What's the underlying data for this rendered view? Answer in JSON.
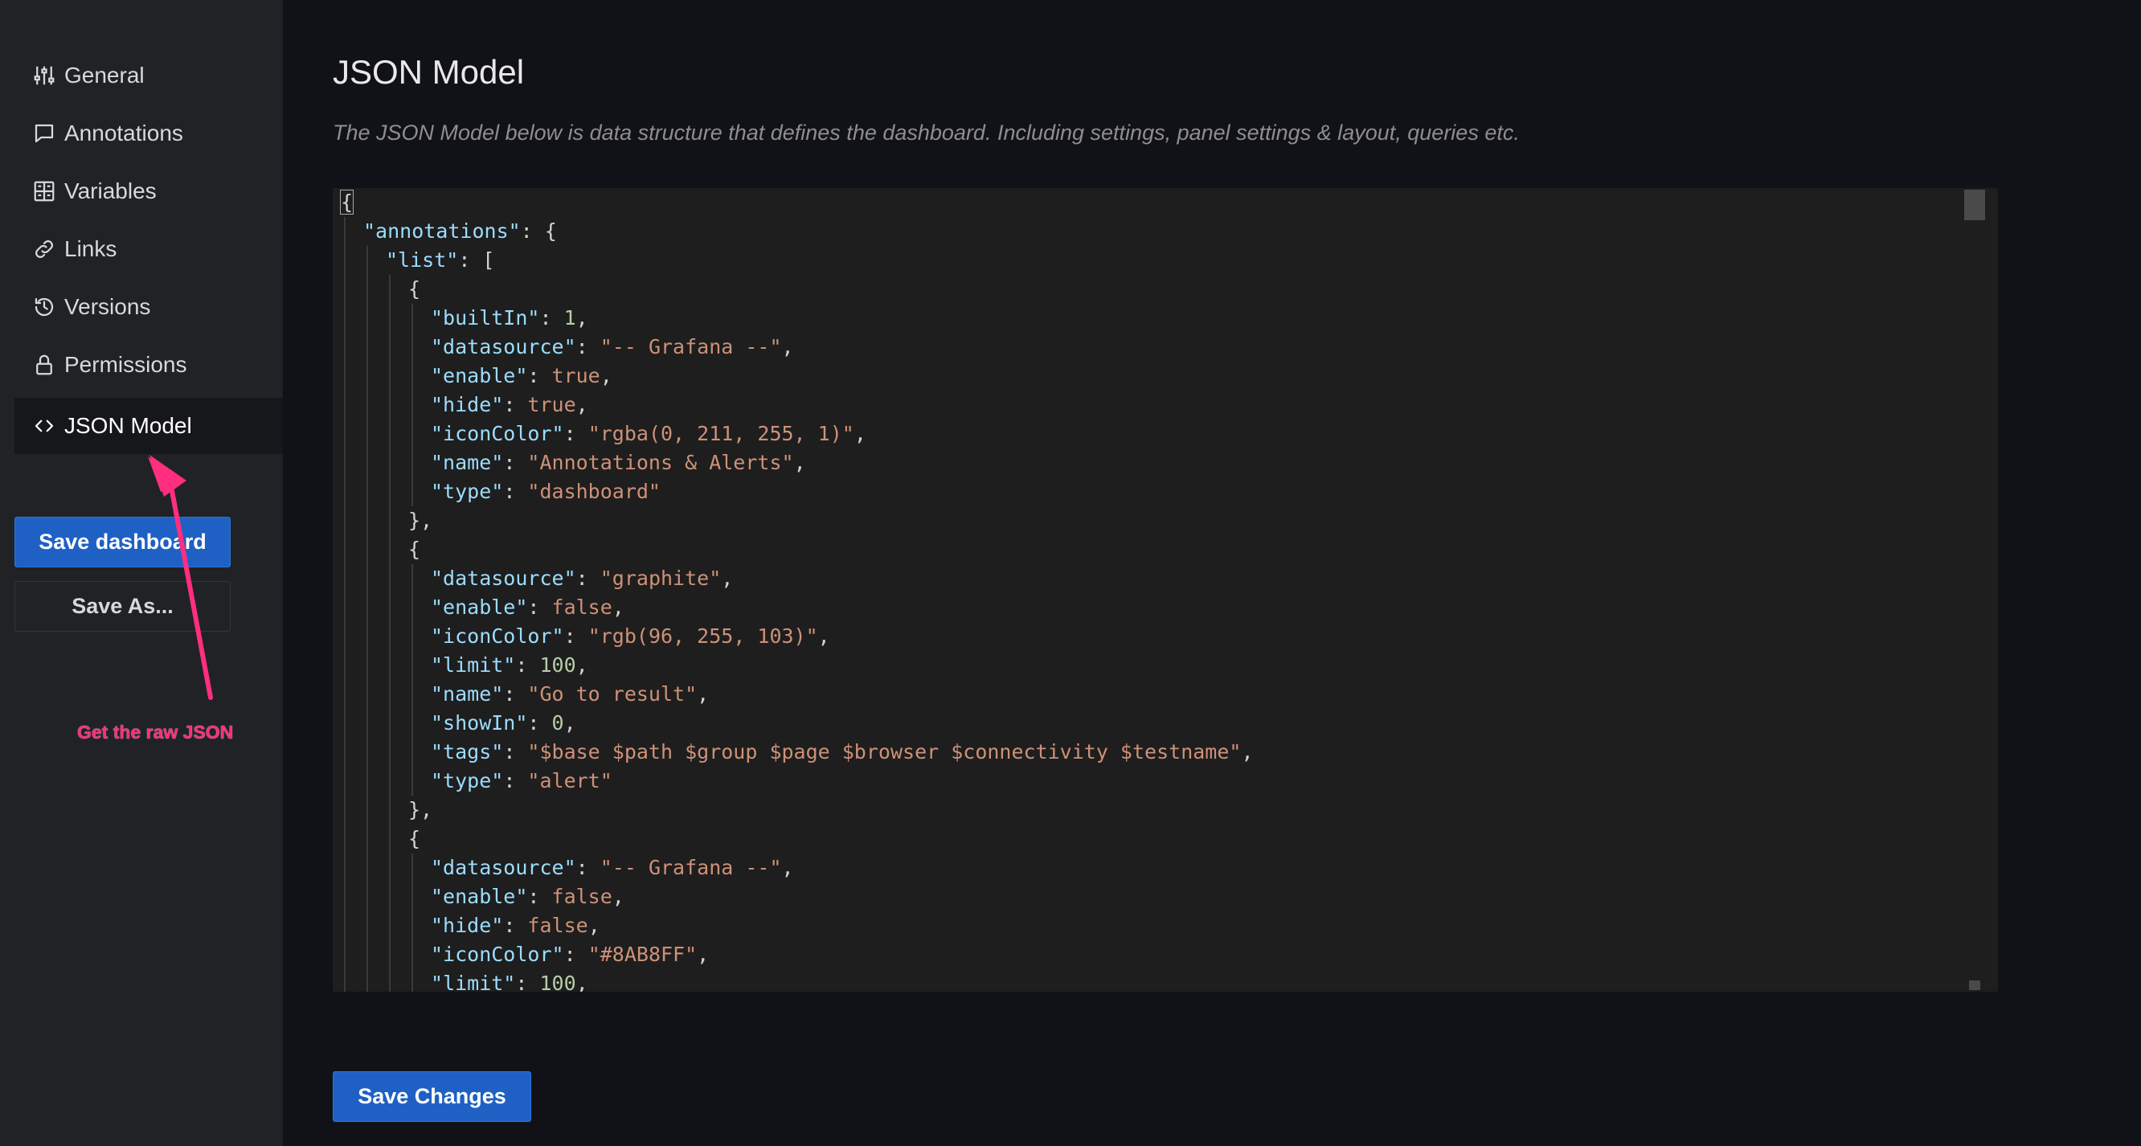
{
  "sidebar": {
    "items": [
      {
        "label": "General",
        "icon": "sliders-icon"
      },
      {
        "label": "Annotations",
        "icon": "comment-icon"
      },
      {
        "label": "Variables",
        "icon": "variables-icon"
      },
      {
        "label": "Links",
        "icon": "link-icon"
      },
      {
        "label": "Versions",
        "icon": "history-icon"
      },
      {
        "label": "Permissions",
        "icon": "lock-icon"
      },
      {
        "label": "JSON Model",
        "icon": "code-brackets-icon"
      }
    ],
    "active_item": "JSON Model",
    "save_dashboard_label": "Save dashboard",
    "save_as_label": "Save As..."
  },
  "main": {
    "title": "JSON Model",
    "description": "The JSON Model below is data structure that defines the dashboard. Including settings, panel settings & layout, queries etc.",
    "save_changes_label": "Save Changes"
  },
  "annotation": {
    "text": "Get the raw JSON"
  },
  "editor": {
    "lines": [
      {
        "indent": 0,
        "tokens": [
          {
            "t": "{",
            "c": "p",
            "cursor": true
          }
        ]
      },
      {
        "indent": 1,
        "tokens": [
          {
            "t": "\"annotations\"",
            "c": "k"
          },
          {
            "t": ": {",
            "c": "p"
          }
        ]
      },
      {
        "indent": 2,
        "tokens": [
          {
            "t": "\"list\"",
            "c": "k"
          },
          {
            "t": ": [",
            "c": "p"
          }
        ]
      },
      {
        "indent": 3,
        "tokens": [
          {
            "t": "{",
            "c": "p"
          }
        ]
      },
      {
        "indent": 4,
        "tokens": [
          {
            "t": "\"builtIn\"",
            "c": "k"
          },
          {
            "t": ": ",
            "c": "p"
          },
          {
            "t": "1",
            "c": "n"
          },
          {
            "t": ",",
            "c": "p"
          }
        ]
      },
      {
        "indent": 4,
        "tokens": [
          {
            "t": "\"datasource\"",
            "c": "k"
          },
          {
            "t": ": ",
            "c": "p"
          },
          {
            "t": "\"-- Grafana --\"",
            "c": "s"
          },
          {
            "t": ",",
            "c": "p"
          }
        ]
      },
      {
        "indent": 4,
        "tokens": [
          {
            "t": "\"enable\"",
            "c": "k"
          },
          {
            "t": ": ",
            "c": "p"
          },
          {
            "t": "true",
            "c": "b"
          },
          {
            "t": ",",
            "c": "p"
          }
        ]
      },
      {
        "indent": 4,
        "tokens": [
          {
            "t": "\"hide\"",
            "c": "k"
          },
          {
            "t": ": ",
            "c": "p"
          },
          {
            "t": "true",
            "c": "b"
          },
          {
            "t": ",",
            "c": "p"
          }
        ]
      },
      {
        "indent": 4,
        "tokens": [
          {
            "t": "\"iconColor\"",
            "c": "k"
          },
          {
            "t": ": ",
            "c": "p"
          },
          {
            "t": "\"rgba(0, 211, 255, 1)\"",
            "c": "s"
          },
          {
            "t": ",",
            "c": "p"
          }
        ]
      },
      {
        "indent": 4,
        "tokens": [
          {
            "t": "\"name\"",
            "c": "k"
          },
          {
            "t": ": ",
            "c": "p"
          },
          {
            "t": "\"Annotations & Alerts\"",
            "c": "s"
          },
          {
            "t": ",",
            "c": "p"
          }
        ]
      },
      {
        "indent": 4,
        "tokens": [
          {
            "t": "\"type\"",
            "c": "k"
          },
          {
            "t": ": ",
            "c": "p"
          },
          {
            "t": "\"dashboard\"",
            "c": "s"
          }
        ]
      },
      {
        "indent": 3,
        "tokens": [
          {
            "t": "},",
            "c": "p"
          }
        ]
      },
      {
        "indent": 3,
        "tokens": [
          {
            "t": "{",
            "c": "p"
          }
        ]
      },
      {
        "indent": 4,
        "tokens": [
          {
            "t": "\"datasource\"",
            "c": "k"
          },
          {
            "t": ": ",
            "c": "p"
          },
          {
            "t": "\"graphite\"",
            "c": "s"
          },
          {
            "t": ",",
            "c": "p"
          }
        ]
      },
      {
        "indent": 4,
        "tokens": [
          {
            "t": "\"enable\"",
            "c": "k"
          },
          {
            "t": ": ",
            "c": "p"
          },
          {
            "t": "false",
            "c": "b"
          },
          {
            "t": ",",
            "c": "p"
          }
        ]
      },
      {
        "indent": 4,
        "tokens": [
          {
            "t": "\"iconColor\"",
            "c": "k"
          },
          {
            "t": ": ",
            "c": "p"
          },
          {
            "t": "\"rgb(96, 255, 103)\"",
            "c": "s"
          },
          {
            "t": ",",
            "c": "p"
          }
        ]
      },
      {
        "indent": 4,
        "tokens": [
          {
            "t": "\"limit\"",
            "c": "k"
          },
          {
            "t": ": ",
            "c": "p"
          },
          {
            "t": "100",
            "c": "n"
          },
          {
            "t": ",",
            "c": "p"
          }
        ]
      },
      {
        "indent": 4,
        "tokens": [
          {
            "t": "\"name\"",
            "c": "k"
          },
          {
            "t": ": ",
            "c": "p"
          },
          {
            "t": "\"Go to result\"",
            "c": "s"
          },
          {
            "t": ",",
            "c": "p"
          }
        ]
      },
      {
        "indent": 4,
        "tokens": [
          {
            "t": "\"showIn\"",
            "c": "k"
          },
          {
            "t": ": ",
            "c": "p"
          },
          {
            "t": "0",
            "c": "n"
          },
          {
            "t": ",",
            "c": "p"
          }
        ]
      },
      {
        "indent": 4,
        "tokens": [
          {
            "t": "\"tags\"",
            "c": "k"
          },
          {
            "t": ": ",
            "c": "p"
          },
          {
            "t": "\"$base $path $group $page $browser $connectivity $testname\"",
            "c": "s"
          },
          {
            "t": ",",
            "c": "p"
          }
        ]
      },
      {
        "indent": 4,
        "tokens": [
          {
            "t": "\"type\"",
            "c": "k"
          },
          {
            "t": ": ",
            "c": "p"
          },
          {
            "t": "\"alert\"",
            "c": "s"
          }
        ]
      },
      {
        "indent": 3,
        "tokens": [
          {
            "t": "},",
            "c": "p"
          }
        ]
      },
      {
        "indent": 3,
        "tokens": [
          {
            "t": "{",
            "c": "p"
          }
        ]
      },
      {
        "indent": 4,
        "tokens": [
          {
            "t": "\"datasource\"",
            "c": "k"
          },
          {
            "t": ": ",
            "c": "p"
          },
          {
            "t": "\"-- Grafana --\"",
            "c": "s"
          },
          {
            "t": ",",
            "c": "p"
          }
        ]
      },
      {
        "indent": 4,
        "tokens": [
          {
            "t": "\"enable\"",
            "c": "k"
          },
          {
            "t": ": ",
            "c": "p"
          },
          {
            "t": "false",
            "c": "b"
          },
          {
            "t": ",",
            "c": "p"
          }
        ]
      },
      {
        "indent": 4,
        "tokens": [
          {
            "t": "\"hide\"",
            "c": "k"
          },
          {
            "t": ": ",
            "c": "p"
          },
          {
            "t": "false",
            "c": "b"
          },
          {
            "t": ",",
            "c": "p"
          }
        ]
      },
      {
        "indent": 4,
        "tokens": [
          {
            "t": "\"iconColor\"",
            "c": "k"
          },
          {
            "t": ": ",
            "c": "p"
          },
          {
            "t": "\"#8AB8FF\"",
            "c": "s"
          },
          {
            "t": ",",
            "c": "p"
          }
        ]
      },
      {
        "indent": 4,
        "tokens": [
          {
            "t": "\"limit\"",
            "c": "k"
          },
          {
            "t": ": ",
            "c": "p"
          },
          {
            "t": "100",
            "c": "n"
          },
          {
            "t": ",",
            "c": "p"
          }
        ]
      }
    ]
  },
  "colors": {
    "primary_button": "#1f60c4",
    "annotation_arrow": "#ff2e7e",
    "json_key": "#9cdcfe",
    "json_string": "#ce9178",
    "json_number": "#b5cea8"
  }
}
